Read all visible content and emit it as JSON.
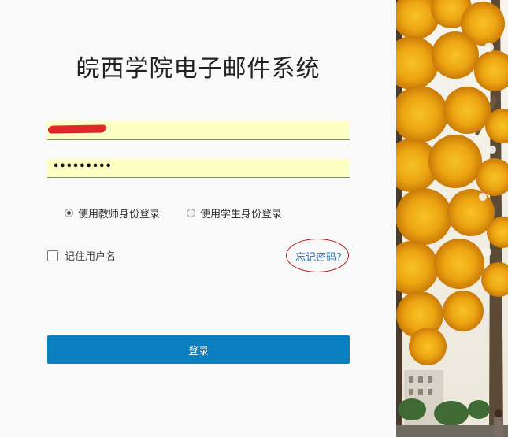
{
  "title": "皖西学院电子邮件系统",
  "username": {
    "value": "",
    "redacted": true
  },
  "password": {
    "masked_value": "•••••••••"
  },
  "login_roles": {
    "teacher_label": "使用教师身份登录",
    "student_label": "使用学生身份登录",
    "selected": "teacher"
  },
  "remember_username": {
    "label": "记住用户名",
    "checked": false
  },
  "forgot_password_label": "忘记密码?",
  "login_button_label": "登录",
  "colors": {
    "primary_button": "#0a7fc0",
    "link": "#2a72b5",
    "field_background": "#fbffc4",
    "field_underline": "#4f8fc9",
    "annotation_circle": "#b71c1c",
    "redaction_mark": "#e0282a"
  },
  "background_image": "autumn-ginkgo-tree-photo"
}
